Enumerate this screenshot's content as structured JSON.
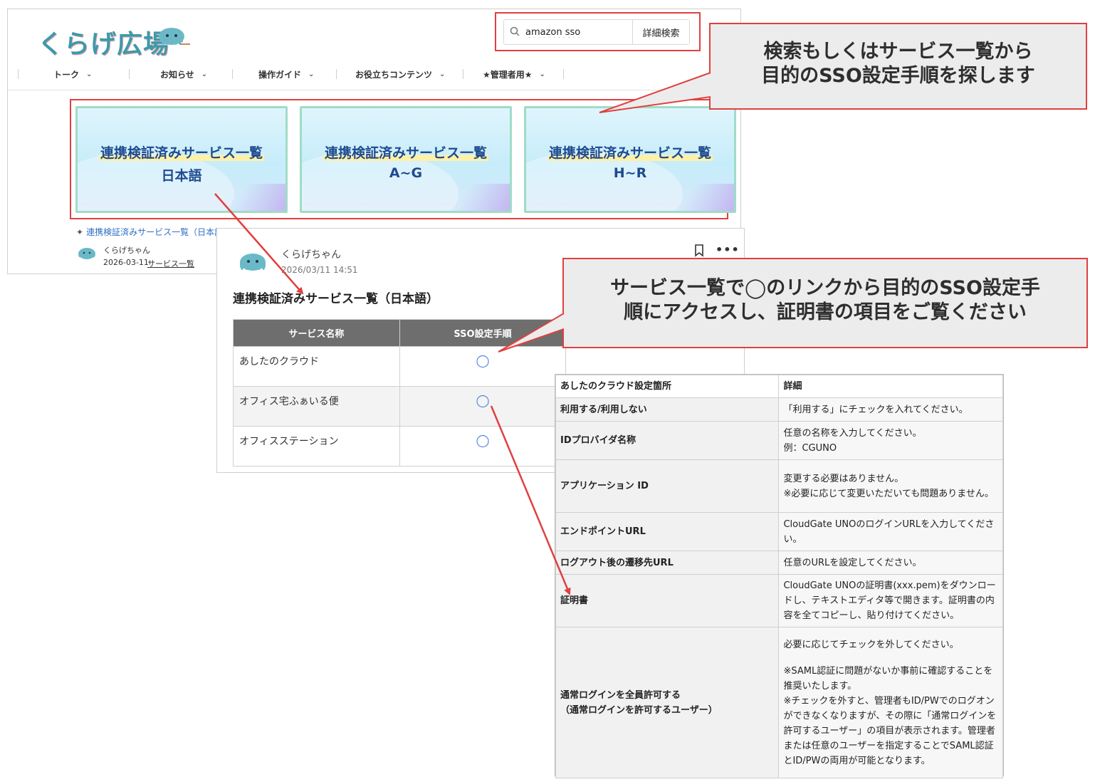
{
  "portal": {
    "logo_text": "くらげ広場",
    "search": {
      "value": "amazon sso",
      "advanced_button": "詳細検索"
    },
    "nav": [
      {
        "label": "トーク"
      },
      {
        "label": "お知らせ"
      },
      {
        "label": "操作ガイド"
      },
      {
        "label": "お役立ちコンテンツ"
      },
      {
        "label": "★管理者用★"
      }
    ],
    "banners": [
      {
        "title": "連携検証済みサービス一覧",
        "subtitle": "日本語"
      },
      {
        "title": "連携検証済みサービス一覧",
        "subtitle": "A~G"
      },
      {
        "title": "連携検証済みサービス一覧",
        "subtitle": "H~R"
      }
    ],
    "post_preview": {
      "link": "連携検証済みサービス一覧（日本語）",
      "author": "くらげちゃん",
      "date": "2026-03-11",
      "category": "サービス一覧"
    }
  },
  "post": {
    "author": "くらげちゃん",
    "datetime": "2026/03/11 14:51",
    "title": "連携検証済みサービス一覧（日本語）",
    "table": {
      "headers": [
        "サービス名称",
        "SSO設定手順"
      ],
      "rows": [
        {
          "name": "あしたのクラウド",
          "link": "◯"
        },
        {
          "name": "オフィス宅ふぁいる便",
          "link": "◯"
        },
        {
          "name": "オフィスステーション",
          "link": "◯"
        }
      ]
    }
  },
  "settings": {
    "headers": [
      "あしたのクラウド設定箇所",
      "詳細"
    ],
    "rows": [
      {
        "key": "利用する/利用しない",
        "value": [
          "「利用する」にチェックを入れてください。"
        ]
      },
      {
        "key": "IDプロバイダ名称",
        "value": [
          "任意の名称を入力してください。",
          "例：CGUNO"
        ]
      },
      {
        "key": "アプリケーション ID",
        "value": [
          "変更する必要はありません。",
          "※必要に応じて変更いただいても問題ありません。"
        ]
      },
      {
        "key": "エンドポイントURL",
        "value": [
          "CloudGate UNOのログインURLを入力してください。"
        ]
      },
      {
        "key": "ログアウト後の遷移先URL",
        "value": [
          "任意のURLを設定してください。"
        ]
      },
      {
        "key": "証明書",
        "value": [
          "CloudGate UNOの証明書(xxx.pem)をダウンロードし、テキストエディタ等で開きます。証明書の内容を全てコピーし、貼り付けてください。"
        ]
      },
      {
        "key": "通常ログインを全員許可する\n（通常ログインを許可するユーザー）",
        "value": [
          "必要に応じてチェックを外してください。",
          "",
          "※SAML認証に問題がないか事前に確認することを推奨いたします。",
          "※チェックを外すと、管理者もID/PWでのログオンができなくなりますが、その際に「通常ログインを許可するユーザー」の項目が表示されます。管理者または任意のユーザーを指定することでSAML認証とID/PWの両用が可能となります。"
        ]
      }
    ]
  },
  "callouts": {
    "search_tip": [
      "検索もしくはサービス一覧から",
      "目的のSSO設定手順を探します"
    ],
    "link_tip": [
      "サービス一覧で◯のリンクから目的のSSO設定手",
      "順にアクセスし、証明書の項目をご覧ください"
    ]
  },
  "colors": {
    "annotation_red": "#e04040",
    "link_blue": "#2d6fc4",
    "banner_text": "#1f4a8f",
    "table_header": "#6e6e6e"
  }
}
